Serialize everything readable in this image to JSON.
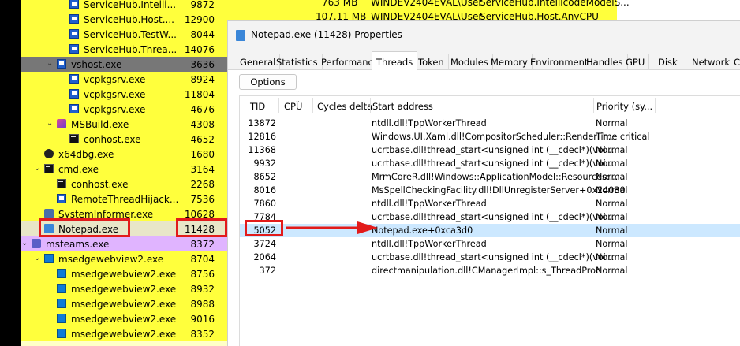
{
  "process_tree": {
    "rows": [
      {
        "name": "ServiceHub.Intelli...",
        "pid": "9872",
        "bg": "yellow",
        "indent": 3,
        "icon": "blue-window-icon"
      },
      {
        "name": "ServiceHub.Host....",
        "pid": "12900",
        "bg": "yellow",
        "indent": 3,
        "icon": "blue-window-icon"
      },
      {
        "name": "ServiceHub.TestW...",
        "pid": "8044",
        "bg": "yellow",
        "indent": 3,
        "icon": "blue-window-icon"
      },
      {
        "name": "ServiceHub.Threa...",
        "pid": "14076",
        "bg": "yellow",
        "indent": 3,
        "icon": "blue-window-icon"
      },
      {
        "name": "vshost.exe",
        "pid": "3636",
        "bg": "gray",
        "indent": 2,
        "icon": "blue-window-icon",
        "twisty": "⌄"
      },
      {
        "name": "vcpkgsrv.exe",
        "pid": "8924",
        "bg": "yellow",
        "indent": 3,
        "icon": "blue-window-icon"
      },
      {
        "name": "vcpkgsrv.exe",
        "pid": "11804",
        "bg": "yellow",
        "indent": 3,
        "icon": "blue-window-icon"
      },
      {
        "name": "vcpkgsrv.exe",
        "pid": "4676",
        "bg": "yellow",
        "indent": 3,
        "icon": "blue-window-icon"
      },
      {
        "name": "MSBuild.exe",
        "pid": "4308",
        "bg": "yellow",
        "indent": 2,
        "icon": "msbuild-icon",
        "twisty": "⌄"
      },
      {
        "name": "conhost.exe",
        "pid": "4652",
        "bg": "yellow",
        "indent": 3,
        "icon": "console-icon"
      },
      {
        "name": "x64dbg.exe",
        "pid": "1680",
        "bg": "yellow",
        "indent": 1,
        "icon": "bug-icon"
      },
      {
        "name": "cmd.exe",
        "pid": "3164",
        "bg": "yellow",
        "indent": 1,
        "icon": "console-icon",
        "twisty": "⌄"
      },
      {
        "name": "conhost.exe",
        "pid": "2268",
        "bg": "yellow",
        "indent": 2,
        "icon": "console-icon"
      },
      {
        "name": "RemoteThreadHijack...",
        "pid": "7536",
        "bg": "yellow",
        "indent": 2,
        "icon": "blue-window-icon"
      },
      {
        "name": "SystemInformer.exe",
        "pid": "10628",
        "bg": "yellow",
        "indent": 1,
        "icon": "system-informer-icon"
      },
      {
        "name": "Notepad.exe",
        "pid": "11428",
        "bg": "sel",
        "indent": 1,
        "icon": "notepad-icon"
      },
      {
        "name": "msteams.exe",
        "pid": "8372",
        "bg": "purple",
        "indent": 0,
        "icon": "teams-icon",
        "twisty": "⌄"
      },
      {
        "name": "msedgewebview2.exe",
        "pid": "8704",
        "bg": "yellow",
        "indent": 1,
        "icon": "edge-webview-icon",
        "twisty": "⌄"
      },
      {
        "name": "msedgewebview2.exe",
        "pid": "8756",
        "bg": "yellow",
        "indent": 2,
        "icon": "edge-webview-icon"
      },
      {
        "name": "msedgewebview2.exe",
        "pid": "8932",
        "bg": "yellow",
        "indent": 2,
        "icon": "edge-webview-icon"
      },
      {
        "name": "msedgewebview2.exe",
        "pid": "8988",
        "bg": "yellow",
        "indent": 2,
        "icon": "edge-webview-icon"
      },
      {
        "name": "msedgewebview2.exe",
        "pid": "9016",
        "bg": "yellow",
        "indent": 2,
        "icon": "edge-webview-icon"
      },
      {
        "name": "msedgewebview2.exe",
        "pid": "8352",
        "bg": "yellow",
        "indent": 2,
        "icon": "edge-webview-icon"
      }
    ]
  },
  "background_row": {
    "memory": "763 MB",
    "user": "WINDEV2404EVAL\\User",
    "description": "ServiceHub.IntellicodeModelS..."
  },
  "background_row2": {
    "memory": "107.11 MB",
    "user": "WINDEV2404EVAL\\User",
    "description": "ServiceHub.Host.AnyCPU"
  },
  "dialog": {
    "title": "Notepad.exe (11428) Properties",
    "tabs": [
      {
        "label": "General",
        "active": false
      },
      {
        "label": "Statistics",
        "active": false
      },
      {
        "label": "Performance",
        "active": false
      },
      {
        "label": "Threads",
        "active": true
      },
      {
        "label": "Token",
        "active": false
      },
      {
        "label": "Modules",
        "active": false
      },
      {
        "label": "Memory",
        "active": false
      },
      {
        "label": "Environment",
        "active": false
      },
      {
        "label": "Handles",
        "active": false
      },
      {
        "label": "GPU",
        "active": false
      },
      {
        "label": "Disk",
        "active": false
      },
      {
        "label": "Network",
        "active": false
      },
      {
        "label": "C",
        "active": false
      }
    ],
    "options_label": "Options",
    "columns": {
      "tid": "TID",
      "cpu": "CPU",
      "cycles": "Cycles delta",
      "start": "Start address",
      "priority": "Priority (sy..."
    },
    "threads": [
      {
        "tid": "13872",
        "start": "ntdll.dll!TppWorkerThread",
        "priority": "Normal"
      },
      {
        "tid": "12816",
        "start": "Windows.UI.Xaml.dll!CompositorScheduler::RenderTh...",
        "priority": "Time critical"
      },
      {
        "tid": "11368",
        "start": "ucrtbase.dll!thread_start<unsigned int (__cdecl*)(voi...",
        "priority": "Normal"
      },
      {
        "tid": "9932",
        "start": "ucrtbase.dll!thread_start<unsigned int (__cdecl*)(voi...",
        "priority": "Normal"
      },
      {
        "tid": "8652",
        "start": "MrmCoreR.dll!Windows::ApplicationModel::Resources:...",
        "priority": "Normal"
      },
      {
        "tid": "8016",
        "start": "MsSpellCheckingFacility.dll!DllUnregisterServer+0x24030",
        "priority": "Normal"
      },
      {
        "tid": "7860",
        "start": "ntdll.dll!TppWorkerThread",
        "priority": "Normal"
      },
      {
        "tid": "7784",
        "start": "ucrtbase.dll!thread_start<unsigned int (__cdecl*)(voi...",
        "priority": "Normal"
      },
      {
        "tid": "5052",
        "start": "Notepad.exe+0xca3d0",
        "priority": "Normal",
        "selected": true
      },
      {
        "tid": "3724",
        "start": "ntdll.dll!TppWorkerThread",
        "priority": "Normal"
      },
      {
        "tid": "2064",
        "start": "ucrtbase.dll!thread_start<unsigned int (__cdecl*)(voi...",
        "priority": "Normal"
      },
      {
        "tid": "372",
        "start": "directmanipulation.dll!CManagerImpl::s_ThreadProc",
        "priority": "Normal"
      }
    ]
  },
  "colors": {
    "process_yellow": "#ffff3c",
    "process_gray": "#777777",
    "process_purple": "#e0b4ff",
    "selection_blue": "#cce8ff",
    "annotation_red": "#e21b1b"
  }
}
